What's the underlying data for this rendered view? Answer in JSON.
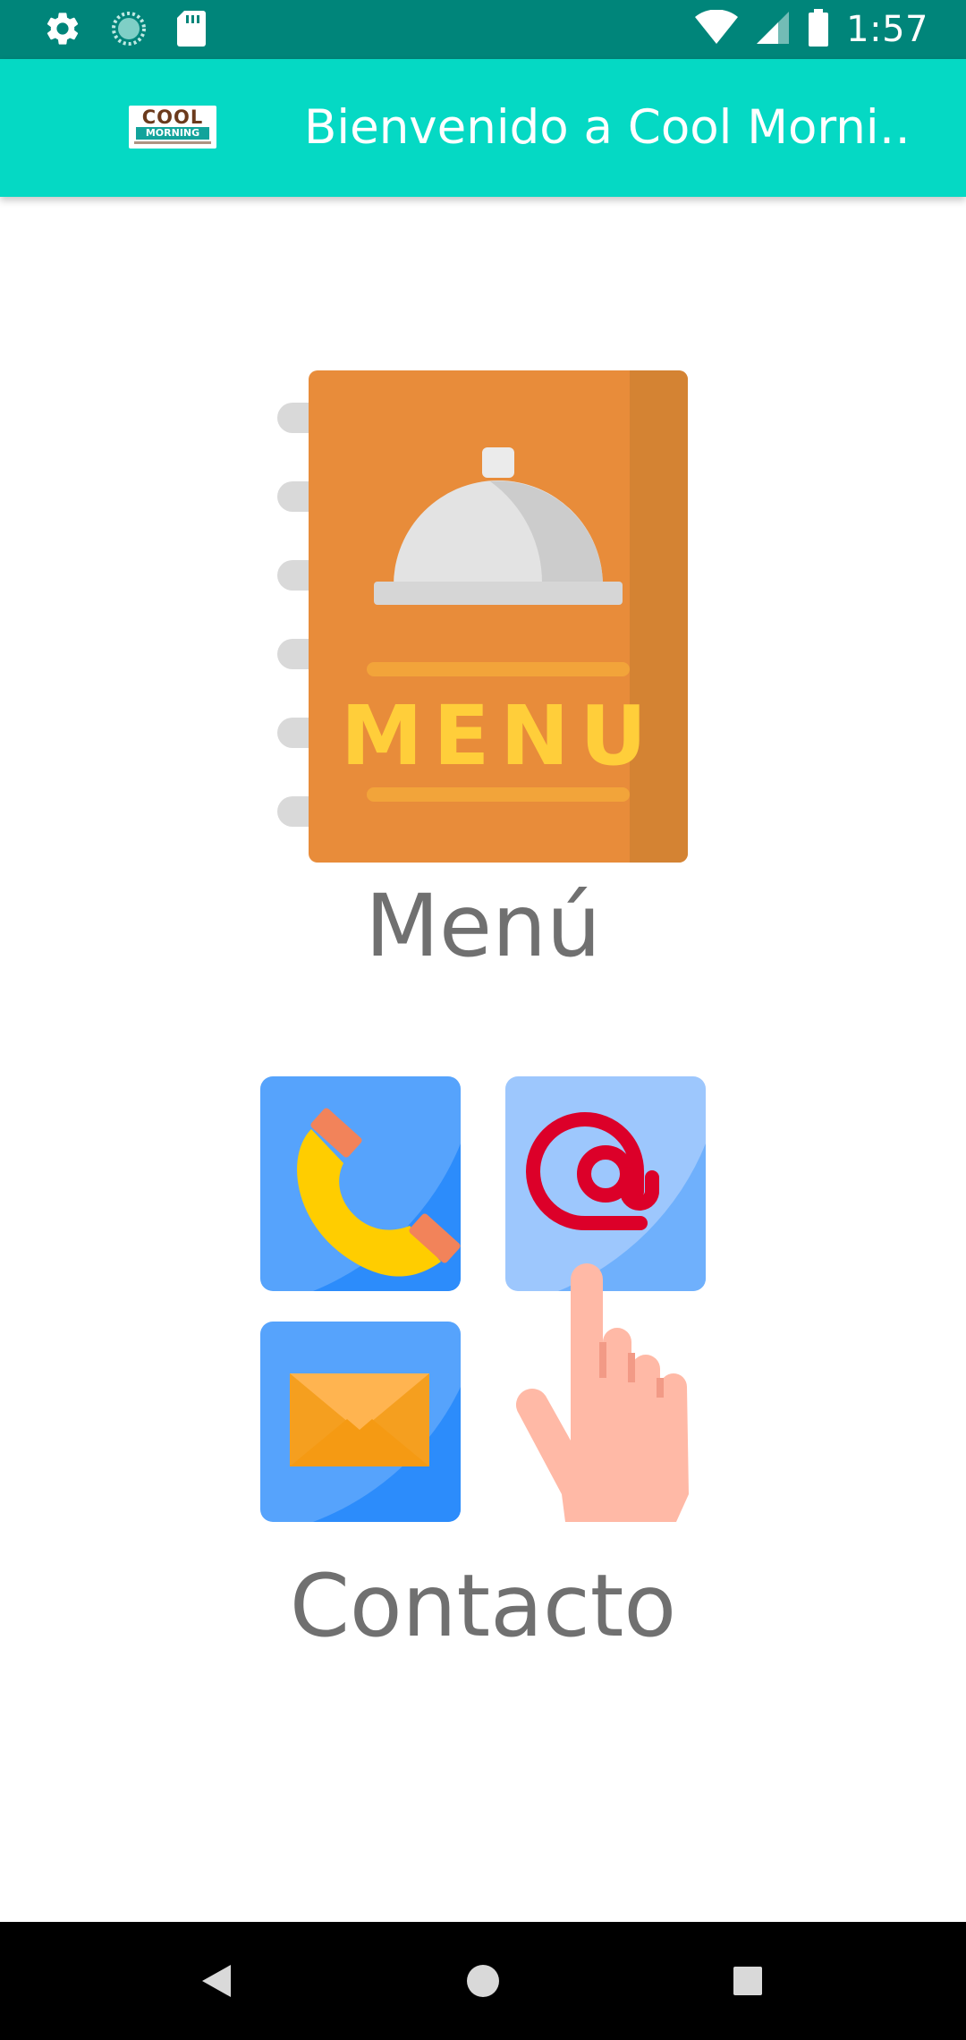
{
  "status_bar": {
    "time": "1:57",
    "left_icons": [
      "settings-icon",
      "loading-circle-icon",
      "sd-card-icon"
    ],
    "right_icons": [
      "wifi-icon",
      "cell-signal-icon",
      "battery-icon"
    ]
  },
  "app_bar": {
    "logo": {
      "line1": "COOL",
      "line2": "MORNING"
    },
    "title": "Bienvenido a Cool Morni…"
  },
  "main": {
    "menu": {
      "image_icon": "menu-book-icon",
      "image_text": "MENU",
      "label": "Menú"
    },
    "contact": {
      "image_icon": "contact-icons",
      "label": "Contacto"
    }
  },
  "nav_bar": {
    "buttons": [
      "back-icon",
      "home-icon",
      "recents-icon"
    ]
  },
  "colors": {
    "status_bar": "#00857a",
    "app_bar": "#05d9c4",
    "label_text": "#707070"
  }
}
